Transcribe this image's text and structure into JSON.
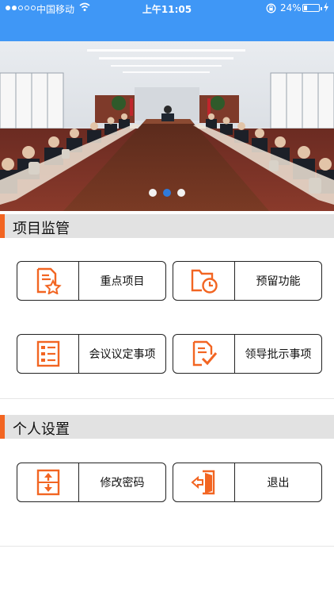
{
  "status_bar": {
    "carrier": "中国移动",
    "time": "上午11:05",
    "battery_pct": "24%",
    "battery_level": 0.24,
    "signal_bars_filled": 2,
    "signal_bars_total": 5
  },
  "banner": {
    "pages": 3,
    "active_page": 2
  },
  "sections": {
    "project": {
      "title": "项目监管",
      "tiles": [
        {
          "label": "重点项目",
          "icon": "star-document-icon"
        },
        {
          "label": "预留功能",
          "icon": "folder-clock-icon"
        },
        {
          "label": "会议议定事项",
          "icon": "list-icon"
        },
        {
          "label": "领导批示事项",
          "icon": "check-document-icon"
        }
      ]
    },
    "personal": {
      "title": "个人设置",
      "tiles": [
        {
          "label": "修改密码",
          "icon": "expand-arrows-icon"
        },
        {
          "label": "退出",
          "icon": "logout-door-icon"
        }
      ]
    }
  },
  "colors": {
    "status_bar": "#3f97f6",
    "accent": "#f26522",
    "pager_active": "#2f7ad9"
  }
}
